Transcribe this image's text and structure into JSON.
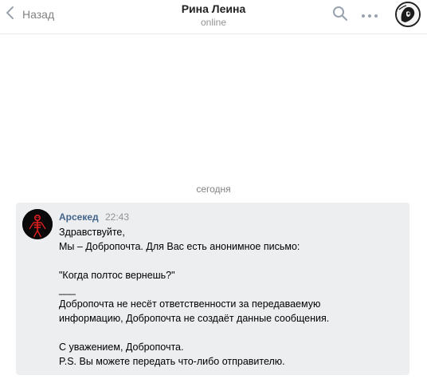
{
  "header": {
    "back_label": "Назад",
    "title": "Рина Леина",
    "status": "online",
    "icons": [
      "chevron-left-icon",
      "search-icon",
      "more-icon"
    ]
  },
  "chat": {
    "date_separator": "сегодня",
    "messages": [
      {
        "sender": "Арсекед",
        "time": "22:43",
        "lines": [
          "Здравствуйте,",
          "Мы – Добропочта. Для Вас есть анонимное письмо:",
          "",
          "\"Когда полтос вернешь?\"",
          "___",
          "Добропочта не несёт ответственности за передаваемую",
          "информацию, Добропочта не создаёт данные сообщения.",
          "",
          "С уважением, Добропочта.",
          "P.S. Вы можете передать что-либо отправителю."
        ]
      }
    ]
  },
  "colors": {
    "sender_link": "#42648b",
    "message_bg": "#edeef0",
    "muted_text": "#939393"
  }
}
